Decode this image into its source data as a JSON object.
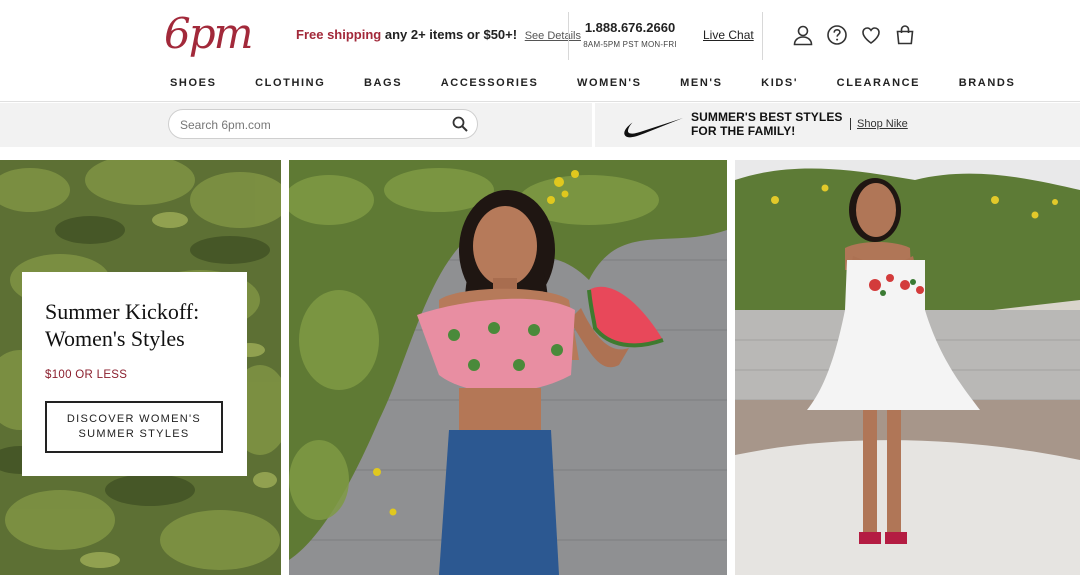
{
  "header": {
    "logo_text": "6pm",
    "promo_accent": "Free shipping",
    "promo_rest": " any 2+ items or $50+!",
    "promo_link": "See Details",
    "phone": "1.888.676.2660",
    "hours": "8AM-5PM PST MON-FRI",
    "live_chat": "Live Chat",
    "icons": [
      "account-icon",
      "help-icon",
      "heart-icon",
      "cart-icon"
    ]
  },
  "nav": {
    "items": [
      "SHOES",
      "CLOTHING",
      "BAGS",
      "ACCESSORIES",
      "WOMEN'S",
      "MEN'S",
      "KIDS'",
      "CLEARANCE",
      "BRANDS"
    ]
  },
  "search": {
    "placeholder": "Search 6pm.com",
    "value": ""
  },
  "nike_promo": {
    "line1": "SUMMER'S BEST STYLES",
    "line2": "FOR THE FAMILY!",
    "link": "Shop Nike"
  },
  "hero": {
    "title_line1": "Summer Kickoff:",
    "title_line2": "Women's Styles",
    "price": "$100 OR LESS",
    "cta_line1": "DISCOVER WOMEN'S",
    "cta_line2": "SUMMER STYLES"
  },
  "colors": {
    "brand": "#a2293a",
    "price": "#8b1f2e",
    "strip": "#f2f2f2",
    "text": "#222222"
  }
}
